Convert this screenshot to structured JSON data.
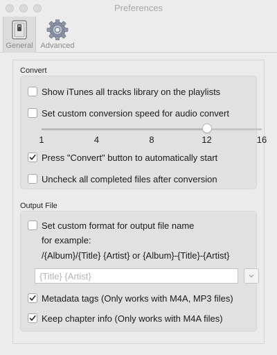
{
  "window": {
    "title": "Preferences"
  },
  "toolbar": {
    "general": {
      "label": "General",
      "icon": "switch-icon"
    },
    "advanced": {
      "label": "Advanced",
      "icon": "gear-icon"
    }
  },
  "convert": {
    "title": "Convert",
    "show_itunes": {
      "label": "Show iTunes all tracks library on the playlists",
      "checked": false
    },
    "custom_speed": {
      "label": "Set custom conversion speed for audio convert",
      "checked": false
    },
    "speed_slider": {
      "ticks": [
        "1",
        "4",
        "8",
        "12",
        "16"
      ],
      "value": 12,
      "min": 1,
      "max": 16
    },
    "auto_start": {
      "label": "Press \"Convert\" button to automatically start",
      "checked": true
    },
    "uncheck_completed": {
      "label": "Uncheck all completed files after conversion",
      "checked": false
    }
  },
  "output": {
    "title": "Output File",
    "custom_format": {
      "label": "Set custom format for output file name",
      "checked": false
    },
    "example_label": "for example:",
    "example_value": "/{Album}/{Title} {Artist} or {Album}-{Title}-{Artist}",
    "format_field": {
      "placeholder": "{Title} {Artist}",
      "value": ""
    },
    "metadata_tags": {
      "label": "Metadata tags (Only works with M4A, MP3 files)",
      "checked": true
    },
    "chapter_info": {
      "label": "Keep chapter info (Only works with M4A files)",
      "checked": true
    }
  }
}
